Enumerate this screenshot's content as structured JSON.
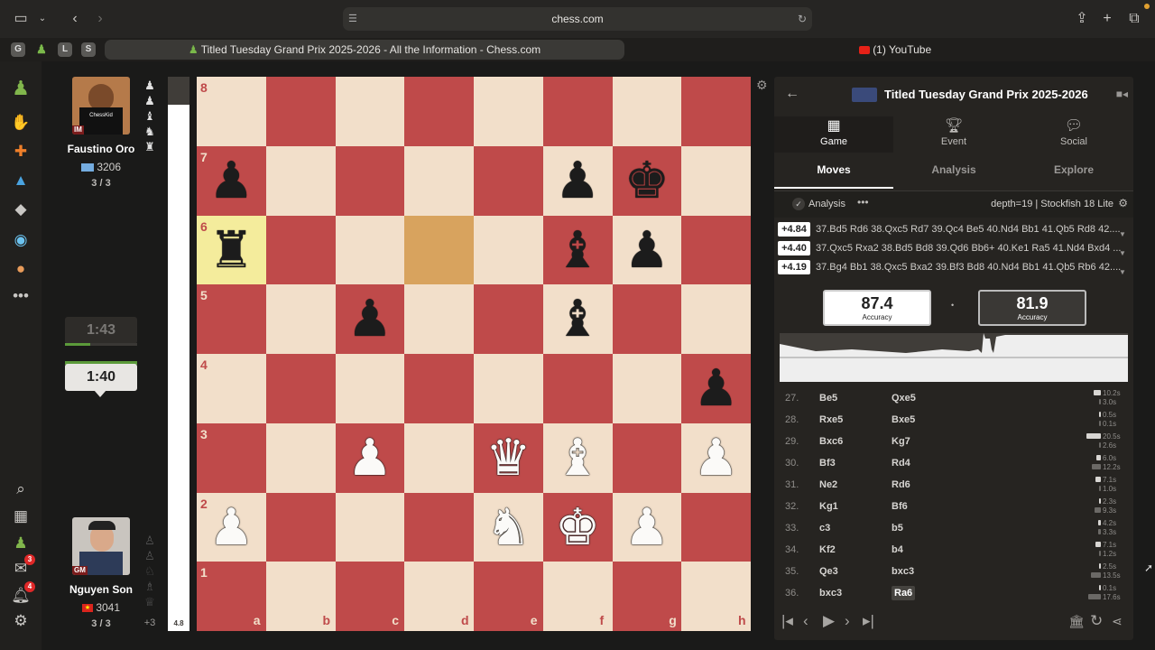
{
  "browser": {
    "url": "chess.com",
    "tabs": [
      {
        "label": "Titled Tuesday Grand Prix 2025-2026 - All the Information - Chess.com",
        "active": true
      },
      {
        "label": "(1) YouTube",
        "active": false
      }
    ],
    "pinned": [
      "G",
      "♟",
      "L",
      "S"
    ]
  },
  "nav": {
    "badges": {
      "mail": "3",
      "bell": "4"
    }
  },
  "players": {
    "top": {
      "name": "Faustino Oro",
      "title": "IM",
      "rating": "3206",
      "score": "3 / 3",
      "clock": "1:43",
      "avatar_text": "ChessKid"
    },
    "bottom": {
      "name": "Nguyen Son",
      "title": "GM",
      "rating": "3041",
      "score": "3 / 3",
      "clock": "1:40",
      "material_diff": "+3"
    }
  },
  "eval": {
    "value": "4.8",
    "white_fraction": 0.95
  },
  "board": {
    "ranks": [
      "8",
      "7",
      "6",
      "5",
      "4",
      "3",
      "2",
      "1"
    ],
    "files": [
      "a",
      "b",
      "c",
      "d",
      "e",
      "f",
      "g",
      "h"
    ]
  },
  "panel": {
    "header_title": "Titled Tuesday Grand Prix 2025-2026",
    "main_tabs": [
      "Game",
      "Event",
      "Social"
    ],
    "sub_tabs": [
      "Moves",
      "Analysis",
      "Explore"
    ],
    "analysis_label": "Analysis",
    "engine": "depth=19 | Stockfish 18 Lite",
    "lines": [
      {
        "eval": "+4.84",
        "moves": "37.Bd5 Rd6 38.Qxc5 Rd7 39.Qc4 Be5 40.Nd4 Bb1 41.Qb5 Rd8 42...."
      },
      {
        "eval": "+4.40",
        "moves": "37.Qxc5 Rxa2 38.Bd5 Bd8 39.Qd6 Bb6+ 40.Ke1 Ra5 41.Nd4 Bxd4 ..."
      },
      {
        "eval": "+4.19",
        "moves": "37.Bg4 Bb1 38.Qxc5 Bxa2 39.Bf3 Bd8 40.Nd4 Bb1 41.Qb5 Rb6 42...."
      }
    ],
    "accuracy": {
      "white": "87.4",
      "black": "81.9",
      "label": "Accuracy",
      "sep": "•"
    },
    "moves": [
      {
        "n": "27.",
        "w": "Be5",
        "b": "Qxe5",
        "tw": "10.2s",
        "tb": "3.0s",
        "fw": 0.5,
        "fb": 0.15
      },
      {
        "n": "28.",
        "w": "Rxe5",
        "b": "Bxe5",
        "tw": "0.5s",
        "tb": "0.1s",
        "fw": 0.03,
        "fb": 0.01
      },
      {
        "n": "29.",
        "w": "Bxc6",
        "b": "Kg7",
        "tw": "20.5s",
        "tb": "2.6s",
        "fw": 1.0,
        "fb": 0.13
      },
      {
        "n": "30.",
        "w": "Bf3",
        "b": "Rd4",
        "tw": "6.0s",
        "tb": "12.2s",
        "fw": 0.3,
        "fb": 0.6
      },
      {
        "n": "31.",
        "w": "Ne2",
        "b": "Rd6",
        "tw": "7.1s",
        "tb": "1.0s",
        "fw": 0.35,
        "fb": 0.05
      },
      {
        "n": "32.",
        "w": "Kg1",
        "b": "Bf6",
        "tw": "2.3s",
        "tb": "9.3s",
        "fw": 0.12,
        "fb": 0.46
      },
      {
        "n": "33.",
        "w": "c3",
        "b": "b5",
        "tw": "4.2s",
        "tb": "3.3s",
        "fw": 0.2,
        "fb": 0.16
      },
      {
        "n": "34.",
        "w": "Kf2",
        "b": "b4",
        "tw": "7.1s",
        "tb": "1.2s",
        "fw": 0.35,
        "fb": 0.06
      },
      {
        "n": "35.",
        "w": "Qe3",
        "b": "bxc3",
        "tw": "2.5s",
        "tb": "13.5s",
        "fw": 0.12,
        "fb": 0.66
      },
      {
        "n": "36.",
        "w": "bxc3",
        "b": "Ra6",
        "tw": "0.1s",
        "tb": "17.6s",
        "fw": 0.01,
        "fb": 0.86,
        "current": true
      }
    ]
  }
}
